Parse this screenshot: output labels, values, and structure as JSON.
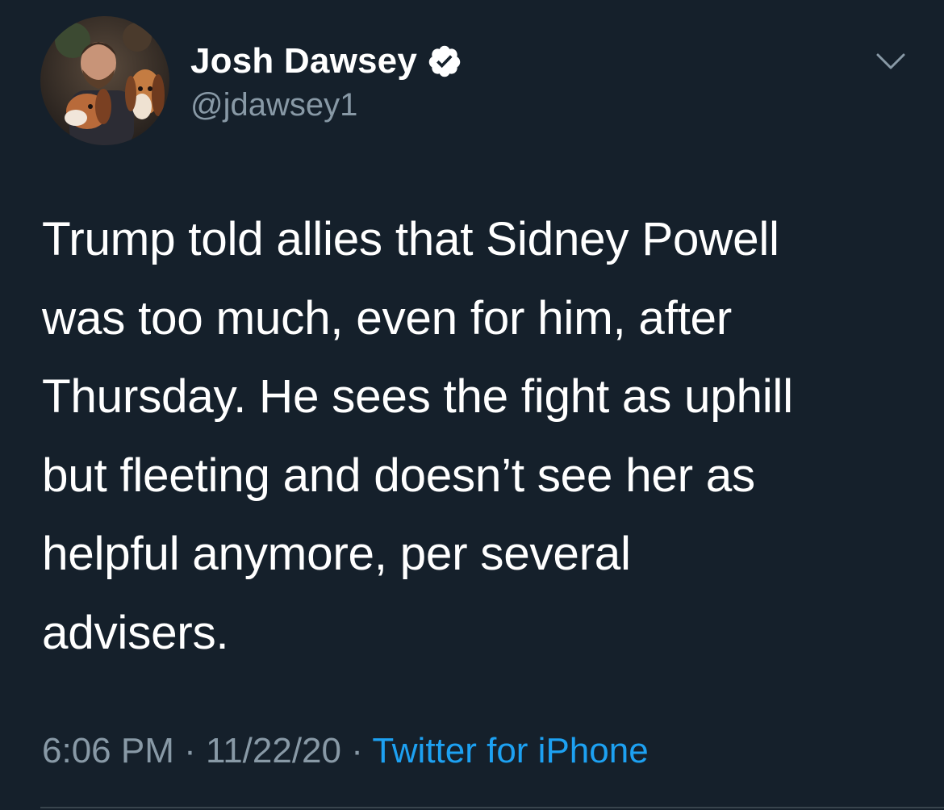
{
  "author": {
    "display_name": "Josh Dawsey",
    "handle": "@jdawsey1",
    "verified": true
  },
  "tweet": {
    "text": "Trump told allies that Sidney Powell\nwas too much, even for him, after\nThursday. He sees the fight as uphill\nbut fleeting and doesn’t see her as\nhelpful anymore, per several\nadvisers.",
    "time": "6:06 PM",
    "separator": " · ",
    "date": "11/22/20",
    "source": "Twitter for iPhone"
  },
  "icons": {
    "verified": "verified-badge-icon",
    "menu": "chevron-down-icon"
  },
  "colors": {
    "background": "#15202b",
    "primary_text": "#ffffff",
    "secondary_text": "#8899a6",
    "link": "#1da1f2",
    "divider": "#38444d"
  }
}
